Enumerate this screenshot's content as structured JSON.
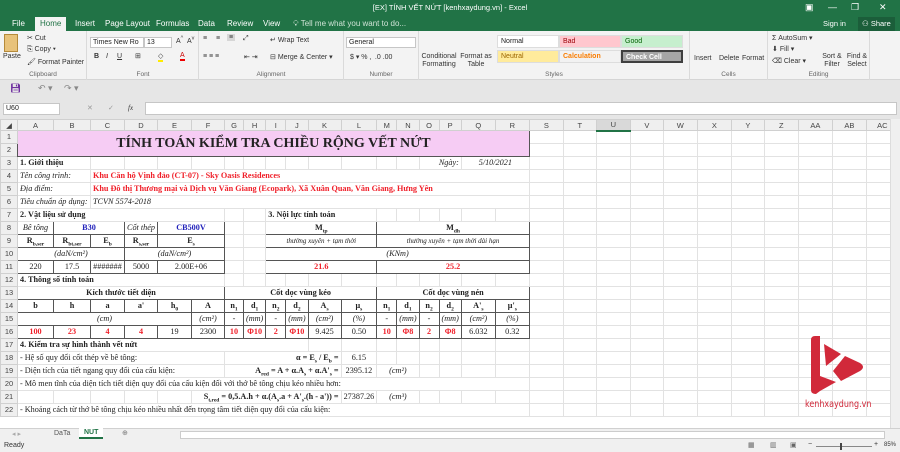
{
  "window": {
    "title": "[EX] TÍNH VẾT NỨT [kenhxaydung.vn] - Excel",
    "sign_in": "Sign in",
    "share": "Share"
  },
  "tabs": [
    "File",
    "Home",
    "Insert",
    "Page Layout",
    "Formulas",
    "Data",
    "Review",
    "View"
  ],
  "tell_me": "Tell me what you want to do...",
  "ribbon": {
    "clipboard": {
      "paste": "Paste",
      "cut": "Cut",
      "copy": "Copy",
      "format_painter": "Format Painter",
      "label": "Clipboard"
    },
    "font": {
      "name": "Times New Ro",
      "size": "13",
      "label": "Font"
    },
    "alignment": {
      "wrap": "Wrap Text",
      "merge": "Merge & Center",
      "label": "Alignment"
    },
    "number": {
      "format": "General",
      "label": "Number"
    },
    "styles": {
      "conditional": "Conditional Formatting",
      "format_table": "Format as Table",
      "normal": "Normal",
      "bad": "Bad",
      "good": "Good",
      "neutral": "Neutral",
      "calculation": "Calculation",
      "check_cell": "Check Cell",
      "label": "Styles"
    },
    "cells": {
      "insert": "Insert",
      "delete": "Delete",
      "format": "Format",
      "label": "Cells"
    },
    "editing": {
      "autosum": "AutoSum",
      "fill": "Fill",
      "clear": "Clear",
      "sort": "Sort & Filter",
      "find": "Find & Select",
      "label": "Editing"
    }
  },
  "formula_bar": {
    "name_box": "U60",
    "fx": "fx",
    "value": ""
  },
  "columns": [
    "A",
    "B",
    "C",
    "D",
    "E",
    "F",
    "G",
    "H",
    "I",
    "J",
    "K",
    "L",
    "M",
    "N",
    "O",
    "P",
    "Q",
    "R",
    "S",
    "T",
    "U",
    "V",
    "W",
    "X",
    "Y",
    "Z",
    "AA",
    "AB",
    "AC"
  ],
  "selected_column": "U",
  "sheet": {
    "title": "TÍNH TOÁN KIỂM TRA CHIỀU RỘNG VẾT NỨT",
    "s1": "1. Giới thiệu",
    "date_label": "Ngày:",
    "date": "5/10/2021",
    "project_label": "Tên công trình:",
    "project": "Khu Căn hộ Vịnh đảo (CT-07) - Sky Oasis Residences",
    "location_label": "Địa điểm:",
    "location": "Khu Đô thị Thương mại và Dịch vụ Văn Giang (Ecopark), Xã Xuân Quan, Văn Giang, Hưng Yên",
    "standard_label": "Tiêu chuẩn áp dụng:",
    "standard": "TCVN 5574-2018",
    "s2": "2. Vật liệu sử dụng",
    "s3": "3. Nội lực tính toán",
    "concrete_label": "Bê tông",
    "concrete": "B30",
    "steel_label": "Cốt thép",
    "steel": "CB500V",
    "mat_unit": "(daN/cm²)",
    "mat_values": [
      "220",
      "17.5",
      "#######",
      "5000",
      "2.00E+06"
    ],
    "m_tp_desc": "thường xuyên + tạm thời",
    "m_dh_desc": "thường xuyên + tạm thời dài hạn",
    "m_unit": "(KNm)",
    "m_tp": "21.6",
    "m_dh": "25.2",
    "s4": "4. Thông số tính toán",
    "g_section": "Kích thước tiết diện",
    "g_tension": "Cốt dọc vùng kéo",
    "g_compression": "Cốt dọc vùng nén",
    "units": [
      "(cm)",
      "(cm²)",
      "-",
      "(mm)",
      "-",
      "(mm)",
      "(cm²)",
      "(%)",
      "-",
      "(mm)",
      "-",
      "(mm)",
      "(cm²)",
      "(%)"
    ],
    "values": [
      "100",
      "23",
      "4",
      "4",
      "19",
      "2300",
      "10",
      "Φ10",
      "2",
      "Φ10",
      "9.425",
      "0.50",
      "10",
      "Φ8",
      "2",
      "Φ8",
      "6.032",
      "0.32"
    ],
    "s5": "4. Kiểm tra sự hình thành vết nứt",
    "l18": "- Hệ số quy đổi cốt thép về bê tông:",
    "v18": "6.15",
    "l19": "- Diện tích của tiết ngang quy đổi của cấu kiện:",
    "v19": "2395.12",
    "u19": "(cm²)",
    "l20": "- Mô men tĩnh của diện tích tiết diện quy đổi của cấu kiện đối với thớ bê tông chịu kéo nhiều hơn:",
    "v21": "27387.26",
    "u21": "(cm³)",
    "l22": "- Khoảng cách từ thớ bê tông chịu kéo nhiều nhất đến trọng tâm tiết diện quy đổi của cấu kiện:"
  },
  "logo_text": "kenhxaydung.vn",
  "sheet_tabs": [
    "DaTa",
    "NUT"
  ],
  "active_sheet": "NUT",
  "status": {
    "ready": "Ready",
    "zoom": "85%"
  },
  "colors": {
    "excel_green": "#217346",
    "title_fill": "#f6ccf4",
    "red": "#f0202a",
    "blue": "#2222bb",
    "logo": "#d1293a"
  }
}
